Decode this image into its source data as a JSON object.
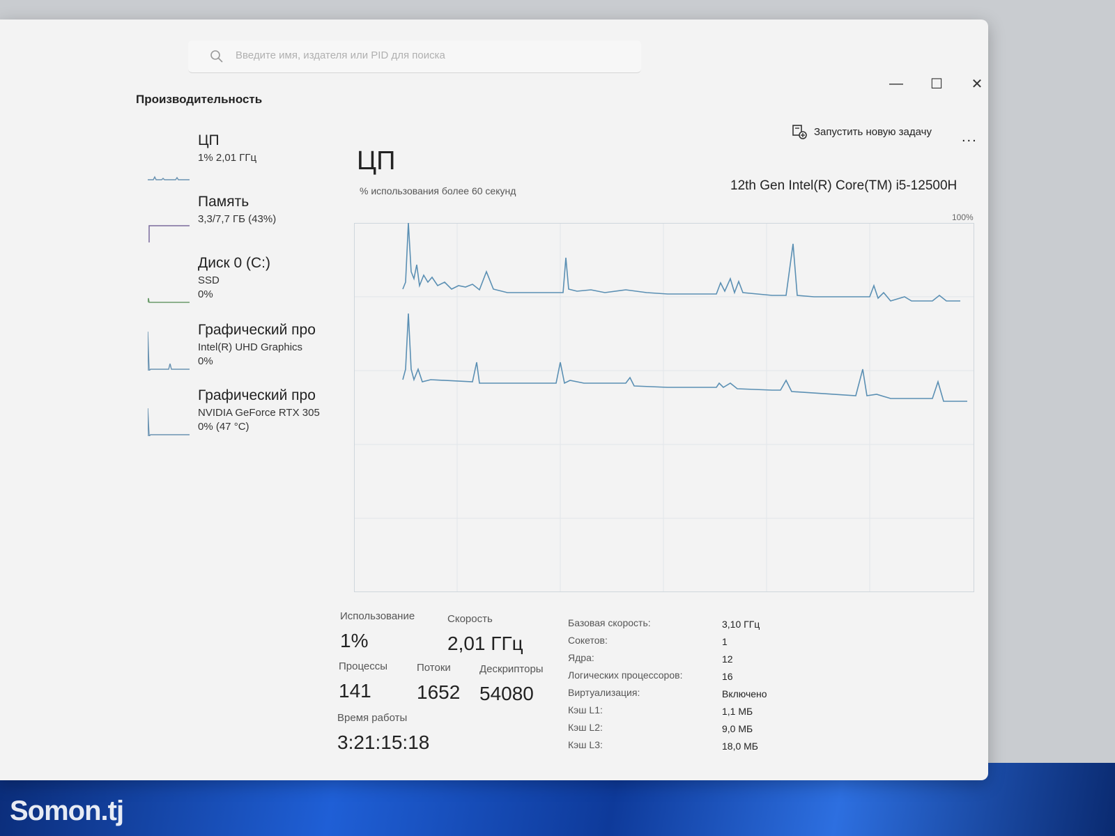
{
  "search": {
    "placeholder": "Введите имя, издателя или PID для поиска"
  },
  "window_controls": {
    "minimize": "—",
    "maximize": "☐",
    "close": "✕"
  },
  "page": {
    "title": "Производительность",
    "run_new_task": "Запустить новую задачу",
    "more": "..."
  },
  "sidebar": {
    "devices": [
      {
        "name": "ЦП",
        "line1": "1% 2,01 ГГц",
        "line2": ""
      },
      {
        "name": "Память",
        "line1": "3,3/7,7 ГБ (43%)",
        "line2": ""
      },
      {
        "name": "Диск 0 (C:)",
        "line1": "SSD",
        "line2": "0%"
      },
      {
        "name": "Графический про",
        "line1": "Intel(R) UHD Graphics",
        "line2": "0%"
      },
      {
        "name": "Графический про",
        "line1": "NVIDIA GeForce RTX 305",
        "line2": "0% (47 °C)"
      }
    ]
  },
  "cpu": {
    "title": "ЦП",
    "graph_caption": "% использования более 60 секунд",
    "model": "12th Gen Intel(R) Core(TM) i5-12500H",
    "max_label": "100%",
    "stats": {
      "usage_label": "Использование",
      "usage_value": "1%",
      "speed_label": "Скорость",
      "speed_value": "2,01 ГГц",
      "processes_label": "Процессы",
      "processes_value": "141",
      "threads_label": "Потоки",
      "threads_value": "1652",
      "handles_label": "Дескрипторы",
      "handles_value": "54080",
      "uptime_label": "Время работы",
      "uptime_value": "3:21:15:18"
    },
    "specs": [
      {
        "label": "Базовая скорость:",
        "value": "3,10 ГГц"
      },
      {
        "label": "Сокетов:",
        "value": "1"
      },
      {
        "label": "Ядра:",
        "value": "12"
      },
      {
        "label": "Логических процессоров:",
        "value": "16"
      },
      {
        "label": "Виртуализация:",
        "value": "Включено"
      },
      {
        "label": "Кэш L1:",
        "value": "1,1 МБ"
      },
      {
        "label": "Кэш L2:",
        "value": "9,0 МБ"
      },
      {
        "label": "Кэш L3:",
        "value": "18,0 МБ"
      }
    ]
  },
  "watermark": "Somon.tj",
  "colors": {
    "graph_line": "#5a8fb3",
    "graph_grid": "#e2e6ea",
    "window_bg": "#f3f3f3"
  }
}
